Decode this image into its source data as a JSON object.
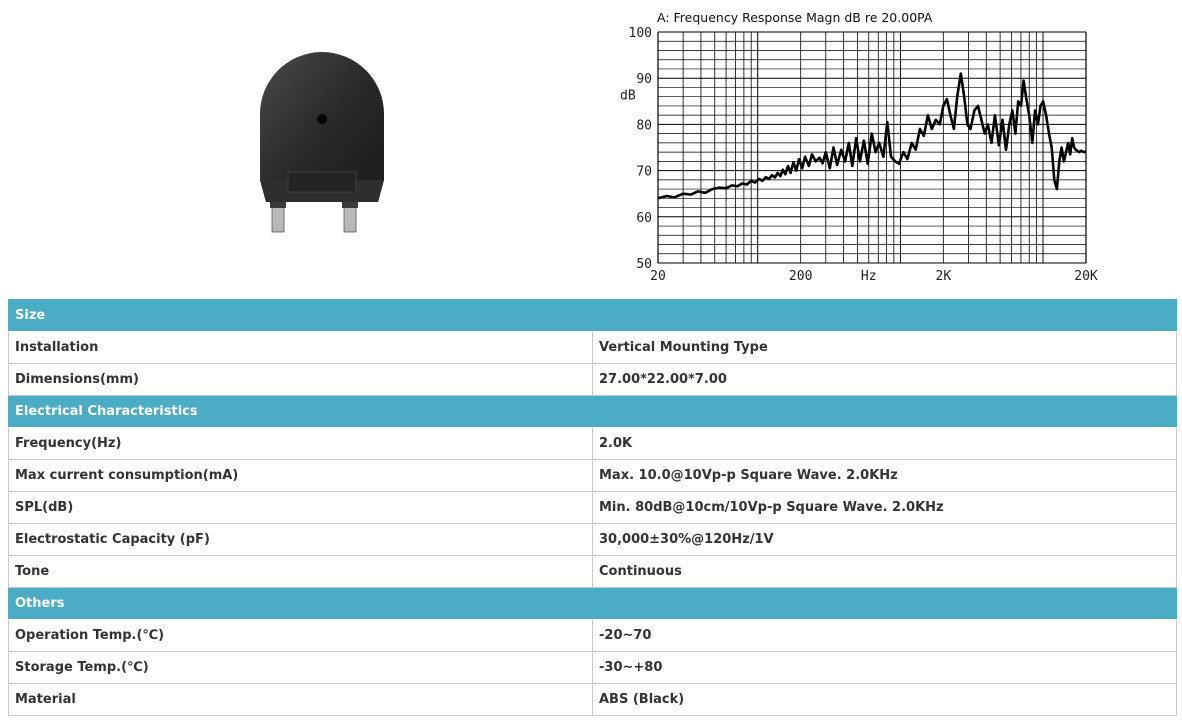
{
  "product": {
    "image_icon": "buzzer-product-photo",
    "body_color": "#2a2a2a",
    "pin_color": "#c9c9c9"
  },
  "chart_data": {
    "type": "line",
    "title": "A: Frequency Response Magn dB re 20.00PA",
    "ylabel": "dB",
    "xlabel": "Hz",
    "x_scale": "log",
    "xlim": [
      20,
      20000
    ],
    "ylim": [
      50,
      100
    ],
    "x_tick_labels": [
      {
        "value": 20,
        "label": "20"
      },
      {
        "value": 200,
        "label": "200"
      },
      {
        "value": 600,
        "label": "Hz"
      },
      {
        "value": 2000,
        "label": "2K"
      },
      {
        "value": 20000,
        "label": "20K"
      }
    ],
    "y_tick_labels": [
      {
        "value": 50,
        "label": "50"
      },
      {
        "value": 60,
        "label": "60"
      },
      {
        "value": 70,
        "label": "70"
      },
      {
        "value": 80,
        "label": "80"
      },
      {
        "value": 90,
        "label": "90"
      },
      {
        "value": 100,
        "label": "100"
      }
    ],
    "y_axis_label_value": 86.5,
    "grid": true,
    "line_color": "#000000",
    "series": [
      {
        "x": [
          20,
          23,
          26,
          30,
          34,
          38,
          43,
          48,
          54,
          60,
          66,
          72,
          78,
          84,
          90,
          96,
          102,
          108,
          114,
          120,
          126,
          132,
          138,
          144,
          150,
          156,
          163,
          170,
          178,
          186,
          195,
          205,
          215,
          228,
          240,
          255,
          270,
          285,
          300,
          320,
          340,
          360,
          385,
          410,
          435,
          460,
          490,
          520,
          555,
          590,
          630,
          670,
          710,
          760,
          810,
          860,
          920,
          980,
          1050,
          1120,
          1200,
          1280,
          1370,
          1460,
          1560,
          1660,
          1770,
          1890,
          2000,
          2120,
          2240,
          2370,
          2500,
          2650,
          2800,
          2950,
          3100,
          3300,
          3500,
          3700,
          3900,
          4100,
          4350,
          4600,
          4900,
          5200,
          5500,
          5800,
          6100,
          6400,
          6700,
          7000,
          7300,
          7600,
          8000,
          8400,
          8800,
          9200,
          9600,
          10000,
          10500,
          11000,
          11500,
          12000,
          12500,
          13000,
          13500,
          14000,
          14500,
          15000,
          15500,
          16000,
          16500,
          17000,
          17500,
          18000,
          18500,
          19000,
          19500,
          20000
        ],
        "values": [
          64,
          64.5,
          64.2,
          65,
          64.8,
          65.5,
          65.2,
          66,
          66.3,
          66.2,
          66.8,
          66.6,
          67.2,
          67,
          67.8,
          67.4,
          68.2,
          67.8,
          68.6,
          68.2,
          69,
          68.5,
          69.5,
          68.8,
          70.2,
          69.2,
          71,
          69.5,
          71.8,
          70,
          72.5,
          70.5,
          73,
          71,
          73.5,
          72,
          72.8,
          71.6,
          74,
          70.5,
          75,
          71.2,
          74.5,
          72,
          76,
          71,
          77,
          72,
          76.5,
          71.5,
          78,
          74,
          76,
          73,
          80.5,
          73,
          72,
          71.5,
          74,
          72.5,
          76,
          74.5,
          79,
          77.5,
          82,
          79,
          81,
          80,
          84,
          85.5,
          82,
          79,
          86,
          91,
          86,
          80,
          79,
          83,
          84,
          81,
          78,
          80,
          76,
          82,
          75.5,
          81,
          74.5,
          80,
          83,
          78,
          85,
          84,
          89.5,
          86,
          82,
          76,
          83,
          80,
          84,
          85,
          82,
          78,
          75,
          68,
          66,
          72,
          75,
          72,
          74,
          76,
          73.5,
          77,
          75,
          74.5,
          74.2,
          74,
          74.3,
          74.1,
          74,
          74.2
        ]
      }
    ]
  },
  "table": {
    "sections": [
      {
        "title": "Size",
        "rows": [
          {
            "label": "Installation",
            "value": "Vertical Mounting Type"
          },
          {
            "label": "Dimensions(mm)",
            "value": "27.00*22.00*7.00"
          }
        ]
      },
      {
        "title": "Electrical Characteristics",
        "rows": [
          {
            "label": "Frequency(Hz)",
            "value": "2.0K"
          },
          {
            "label": "Max current consumption(mA)",
            "value": "Max. 10.0@10Vp-p Square Wave. 2.0KHz"
          },
          {
            "label": "SPL(dB)",
            "value": "Min. 80dB@10cm/10Vp-p Square Wave. 2.0KHz"
          },
          {
            "label": "Electrostatic Capacity (pF)",
            "value": "30,000±30%@120Hz/1V"
          },
          {
            "label": "Tone",
            "value": "Continuous"
          }
        ]
      },
      {
        "title": "Others",
        "rows": [
          {
            "label": "Operation Temp.(℃)",
            "value": "-20~70"
          },
          {
            "label": "Storage Temp.(℃)",
            "value": "-30~+80"
          },
          {
            "label": "Material",
            "value": "ABS (Black)"
          }
        ]
      }
    ],
    "header_color": "#4bacc6"
  }
}
